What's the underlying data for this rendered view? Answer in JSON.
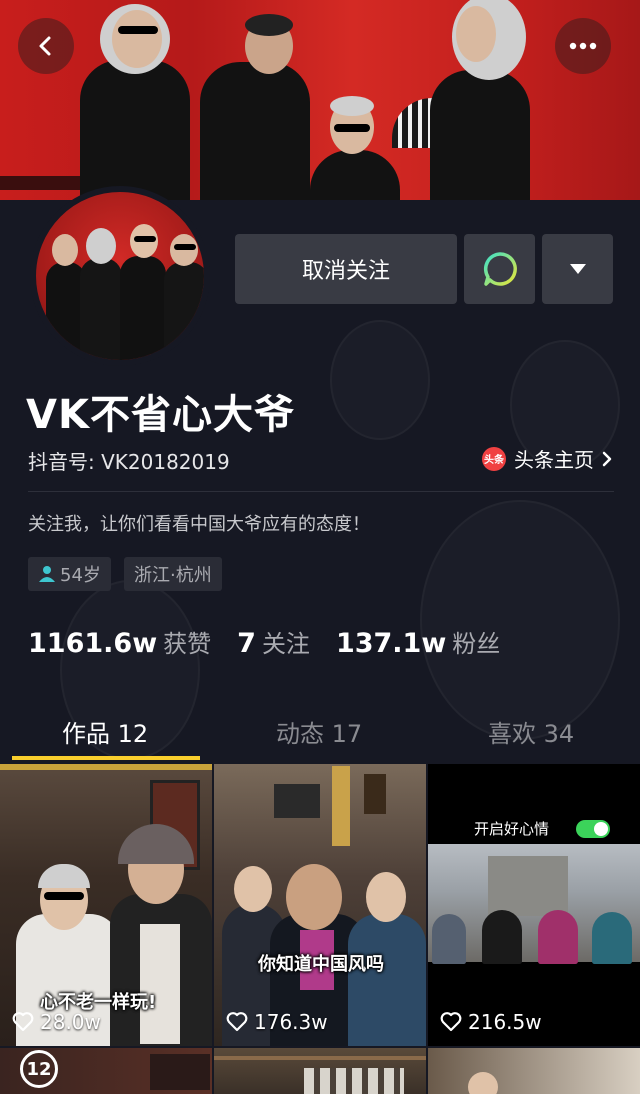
{
  "profile": {
    "name": "VK不省心大爷",
    "douyin_id": "抖音号: VK20182019",
    "toutiao_logo": "头条",
    "toutiao_link": "头条主页",
    "bio": "关注我，让你们看看中国大爷应有的态度！",
    "tags": {
      "age": "54岁",
      "location": "浙江·杭州"
    }
  },
  "actions": {
    "unfollow": "取消关注",
    "message_icon": "chat-bubble-icon",
    "more_icon": "caret-down-icon"
  },
  "nav": {
    "back_icon": "back-chevron-icon",
    "menu_icon": "more-dots-icon"
  },
  "stats": [
    {
      "value": "1161.6w",
      "label": "获赞"
    },
    {
      "value": "7",
      "label": "关注"
    },
    {
      "value": "137.1w",
      "label": "粉丝"
    }
  ],
  "tabs": [
    {
      "label": "作品 12",
      "active": true
    },
    {
      "label": "动态 17",
      "active": false
    },
    {
      "label": "喜欢 34",
      "active": false
    }
  ],
  "videos": [
    {
      "caption": "心不老一样玩!",
      "likes": "28.0w",
      "pinned_num": "12"
    },
    {
      "caption": "你知道中国风吗",
      "likes": "176.3w"
    },
    {
      "caption": "开启好心情",
      "likes": "216.5w"
    }
  ],
  "colors": {
    "background": "#161823",
    "tab_indicator": "#facf2d",
    "toggle_on": "#3bd35a"
  }
}
